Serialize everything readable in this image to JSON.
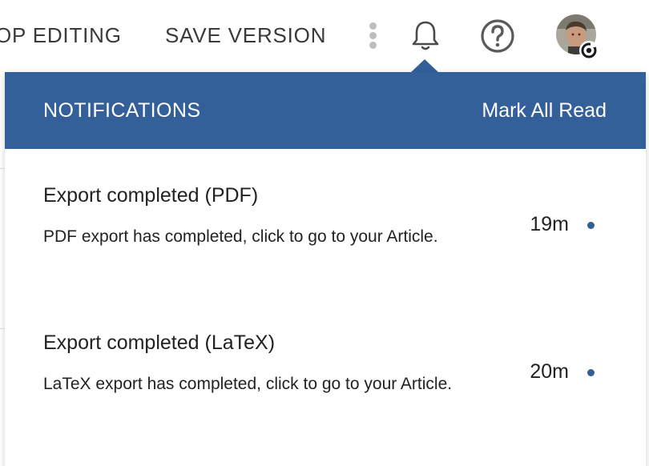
{
  "topbar": {
    "stop_editing": "OP EDITING",
    "save_version": "SAVE VERSION"
  },
  "icons": {
    "more": "kebab-vertical-icon",
    "notifications": "bell-icon",
    "help": "question-circle-icon",
    "avatar": "user-avatar",
    "status": "status-ring-icon"
  },
  "colors": {
    "accent": "#34609a",
    "text": "#222222",
    "topbar_text": "#3a3a3a"
  },
  "notifications": {
    "title": "NOTIFICATIONS",
    "mark_all_read": "Mark All Read",
    "items": [
      {
        "title": "Export completed (PDF)",
        "body": "PDF export has completed, click to go to your Article.",
        "time": "19m",
        "unread": true
      },
      {
        "title": "Export completed (LaTeX)",
        "body": "LaTeX export has completed, click to go to your Article.",
        "time": "20m",
        "unread": true
      }
    ]
  }
}
